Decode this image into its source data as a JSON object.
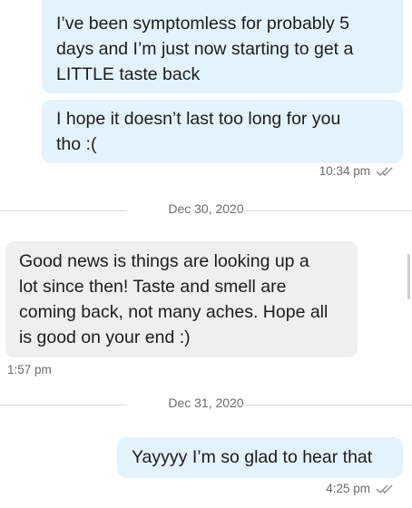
{
  "messages": [
    {
      "direction": "outgoing",
      "text_lines": [
        "I’ve been symptomless for probably 5",
        "days and I’m just now starting to get a",
        "LITTLE taste back"
      ]
    },
    {
      "direction": "outgoing",
      "text_lines": [
        "I hope it doesn’t last too long for you",
        "tho :("
      ]
    },
    {
      "direction": "incoming",
      "text_lines": [
        "Good news is things are looking up a",
        "lot since then! Taste and smell are",
        "coming back, not many aches. Hope all",
        "is good on your end :)"
      ]
    },
    {
      "direction": "outgoing",
      "text_lines": [
        "Yayyyy I’m so glad to hear that"
      ]
    }
  ],
  "timestamps": {
    "group1": "10:34 pm",
    "group2": "1:57 pm",
    "group3": "4:25 pm"
  },
  "dates": {
    "divider1": "Dec 30, 2020",
    "divider2": "Dec 31, 2020"
  },
  "icons": {
    "read_receipt": "double-check-icon"
  },
  "colors": {
    "outgoing_bubble": "#e3f3fb",
    "incoming_bubble": "#efefef",
    "meta_text": "#6b6b6b"
  }
}
